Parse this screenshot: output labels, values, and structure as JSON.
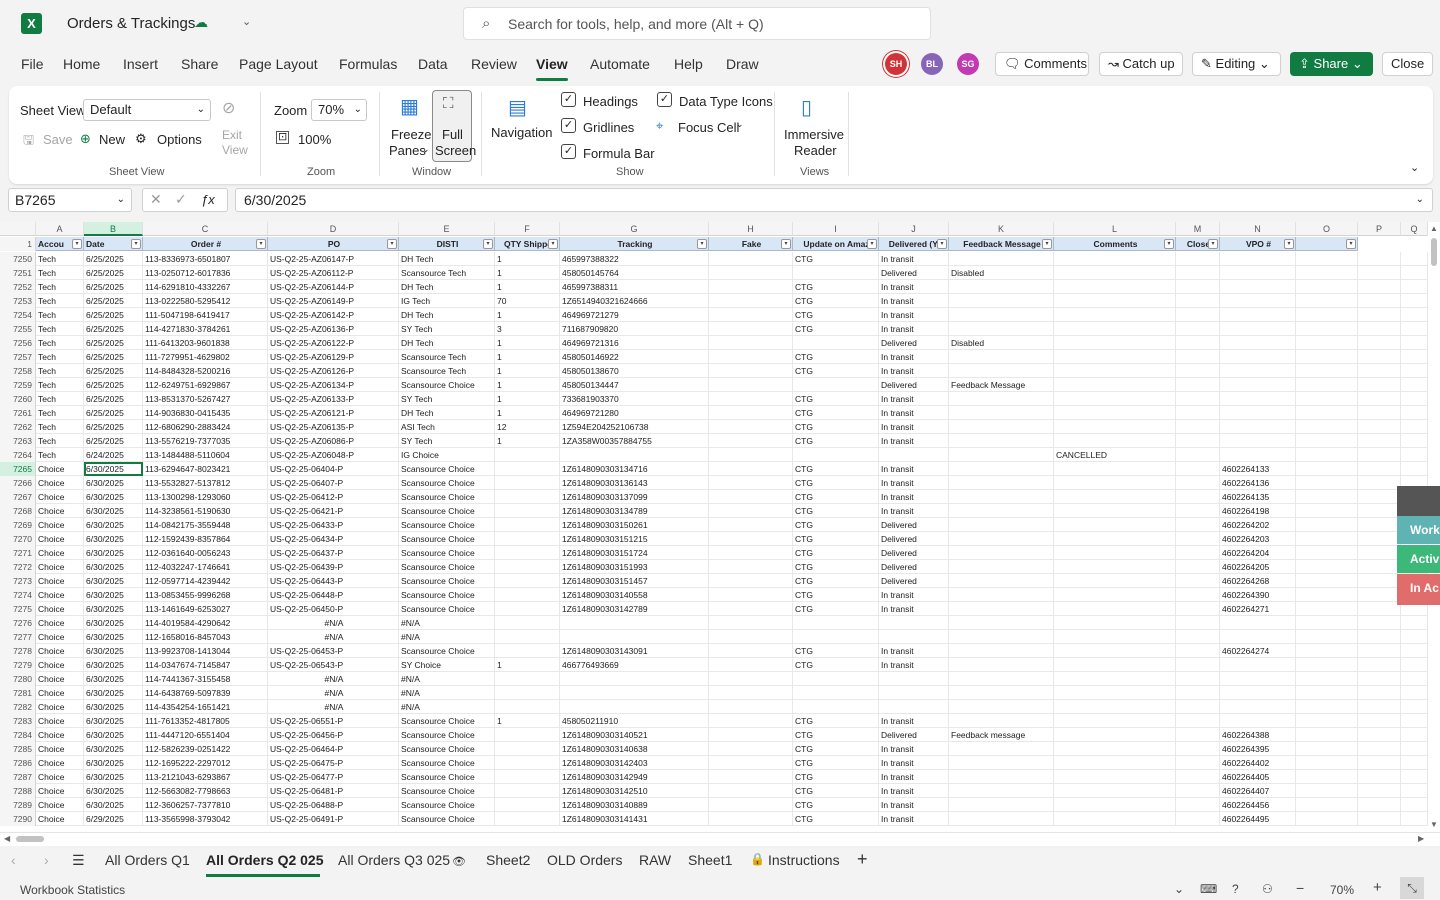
{
  "title": {
    "app_name": "Orders & Trackings",
    "search_placeholder": "Search for tools, help, and more (Alt + Q)",
    "logo_letter": "X"
  },
  "menu": [
    "File",
    "Home",
    "Insert",
    "Share",
    "Page Layout",
    "Formulas",
    "Data",
    "Review",
    "View",
    "Automate",
    "Help",
    "Draw"
  ],
  "avatars": [
    "SH",
    "BL",
    "SG"
  ],
  "topbar": {
    "comments": "Comments",
    "catchup": "Catch up",
    "editing": "Editing",
    "share": "Share",
    "close": "Close"
  },
  "ribbon": {
    "sheet_view_label": "Sheet View",
    "sheet_view_value": "Default",
    "exit_view": "Exit\nView",
    "save": "Save",
    "new": "New",
    "options": "Options",
    "grp_sheetview": "Sheet View",
    "zoom_label": "Zoom",
    "zoom_value": "70%",
    "zoom_100": "100%",
    "grp_zoom": "Zoom",
    "freeze": "Freeze",
    "panes": "Panes",
    "full": "Full",
    "screen": "Screen",
    "grp_window": "Window",
    "navigation": "Navigation",
    "headings": "Headings",
    "gridlines": "Gridlines",
    "formula_bar": "Formula Bar",
    "data_type_icons": "Data Type Icons",
    "focus_cell": "Focus Cell",
    "grp_show": "Show",
    "immersive": "Immersive",
    "reader": "Reader",
    "grp_views": "Views"
  },
  "formula": {
    "namebox": "B7265",
    "value": "6/30/2025"
  },
  "columns": [
    "A",
    "B",
    "C",
    "D",
    "E",
    "F",
    "G",
    "H",
    "I",
    "J",
    "K",
    "L",
    "M",
    "N",
    "O",
    "P",
    "Q"
  ],
  "headers": [
    "Accou",
    "Date",
    "Order #",
    "PO",
    "DISTI",
    "QTY Shippe",
    "Tracking",
    "Fake",
    "Update on Amaz",
    "Delivered (Y/",
    "Feedback Message",
    "Comments",
    "Close",
    "VPO #",
    ""
  ],
  "header_rownum": "1",
  "rows": [
    [
      "7250",
      "Tech",
      "6/25/2025",
      "113-8336973-6501807",
      "US-Q2-25-AZ06147-P",
      "DH Tech",
      "1",
      "465997388322",
      "",
      "CTG",
      "In transit",
      "",
      "",
      "",
      ""
    ],
    [
      "7251",
      "Tech",
      "6/25/2025",
      "113-0250712-6017836",
      "US-Q2-25-AZ06112-P",
      "Scansource Tech",
      "1",
      "458050145764",
      "",
      "",
      "Delivered",
      "Disabled",
      "",
      "",
      ""
    ],
    [
      "7252",
      "Tech",
      "6/25/2025",
      "114-6291810-4332267",
      "US-Q2-25-AZ06144-P",
      "DH Tech",
      "1",
      "465997388311",
      "",
      "CTG",
      "In transit",
      "",
      "",
      "",
      ""
    ],
    [
      "7253",
      "Tech",
      "6/25/2025",
      "113-0222580-5295412",
      "US-Q2-25-AZ06149-P",
      "IG Tech",
      "70",
      "1Z6514940321624666",
      "",
      "CTG",
      "In transit",
      "",
      "",
      "",
      ""
    ],
    [
      "7254",
      "Tech",
      "6/25/2025",
      "111-5047198-6419417",
      "US-Q2-25-AZ06142-P",
      "DH Tech",
      "1",
      "464969721279",
      "",
      "CTG",
      "In transit",
      "",
      "",
      "",
      ""
    ],
    [
      "7255",
      "Tech",
      "6/25/2025",
      "114-4271830-3784261",
      "US-Q2-25-AZ06136-P",
      "SY Tech",
      "3",
      "711687909820",
      "",
      "CTG",
      "In transit",
      "",
      "",
      "",
      ""
    ],
    [
      "7256",
      "Tech",
      "6/25/2025",
      "111-6413203-9601838",
      "US-Q2-25-AZ06122-P",
      "DH Tech",
      "1",
      "464969721316",
      "",
      "",
      "Delivered",
      "Disabled",
      "",
      "",
      ""
    ],
    [
      "7257",
      "Tech",
      "6/25/2025",
      "111-7279951-4629802",
      "US-Q2-25-AZ06129-P",
      "Scansource Tech",
      "1",
      "458050146922",
      "",
      "CTG",
      "In transit",
      "",
      "",
      "",
      ""
    ],
    [
      "7258",
      "Tech",
      "6/25/2025",
      "114-8484328-5200216",
      "US-Q2-25-AZ06126-P",
      "Scansource Tech",
      "1",
      "458050138670",
      "",
      "CTG",
      "In transit",
      "",
      "",
      "",
      ""
    ],
    [
      "7259",
      "Tech",
      "6/25/2025",
      "112-6249751-6929867",
      "US-Q2-25-AZ06134-P",
      "Scansource Choice",
      "1",
      "458050134447",
      "",
      "",
      "Delivered",
      "Feedback Message",
      "",
      "",
      ""
    ],
    [
      "7260",
      "Tech",
      "6/25/2025",
      "113-8531370-5267427",
      "US-Q2-25-AZ06133-P",
      "SY Tech",
      "1",
      "733681903370",
      "",
      "CTG",
      "In transit",
      "",
      "",
      "",
      ""
    ],
    [
      "7261",
      "Tech",
      "6/25/2025",
      "114-9036830-0415435",
      "US-Q2-25-AZ06121-P",
      "DH Tech",
      "1",
      "464969721280",
      "",
      "CTG",
      "In transit",
      "",
      "",
      "",
      ""
    ],
    [
      "7262",
      "Tech",
      "6/25/2025",
      "112-6806290-2883424",
      "US-Q2-25-AZ06135-P",
      "ASI Tech",
      "12",
      "1Z594E204252106738",
      "",
      "CTG",
      "In transit",
      "",
      "",
      "",
      ""
    ],
    [
      "7263",
      "Tech",
      "6/25/2025",
      "113-5576219-7377035",
      "US-Q2-25-AZ06086-P",
      "SY Tech",
      "1",
      "1ZA358W00357884755",
      "",
      "CTG",
      "In transit",
      "",
      "",
      "",
      ""
    ],
    [
      "7264",
      "Tech",
      "6/24/2025",
      "113-1484488-5110604",
      "US-Q2-25-AZ06048-P",
      "IG Choice",
      "",
      "",
      "",
      "",
      "",
      "",
      "CANCELLED",
      "",
      ""
    ],
    [
      "7265",
      "Choice",
      "6/30/2025",
      "113-6294647-8023421",
      "US-Q2-25-06404-P",
      "Scansource Choice",
      "",
      "1Z6148090303134716",
      "",
      "CTG",
      "In transit",
      "",
      "",
      "",
      "4602264133"
    ],
    [
      "7266",
      "Choice",
      "6/30/2025",
      "113-5532827-5137812",
      "US-Q2-25-06407-P",
      "Scansource Choice",
      "",
      "1Z6148090303136143",
      "",
      "CTG",
      "In transit",
      "",
      "",
      "",
      "4602264136"
    ],
    [
      "7267",
      "Choice",
      "6/30/2025",
      "113-1300298-1293060",
      "US-Q2-25-06412-P",
      "Scansource Choice",
      "",
      "1Z6148090303137099",
      "",
      "CTG",
      "In transit",
      "",
      "",
      "",
      "4602264135"
    ],
    [
      "7268",
      "Choice",
      "6/30/2025",
      "114-3238561-5190630",
      "US-Q2-25-06421-P",
      "Scansource Choice",
      "",
      "1Z6148090303134789",
      "",
      "CTG",
      "In transit",
      "",
      "",
      "",
      "4602264198"
    ],
    [
      "7269",
      "Choice",
      "6/30/2025",
      "114-0842175-3559448",
      "US-Q2-25-06433-P",
      "Scansource Choice",
      "",
      "1Z6148090303150261",
      "",
      "CTG",
      "Delivered",
      "",
      "",
      "",
      "4602264202"
    ],
    [
      "7270",
      "Choice",
      "6/30/2025",
      "112-1592439-8357864",
      "US-Q2-25-06434-P",
      "Scansource Choice",
      "",
      "1Z6148090303151215",
      "",
      "CTG",
      "Delivered",
      "",
      "",
      "",
      "4602264203"
    ],
    [
      "7271",
      "Choice",
      "6/30/2025",
      "112-0361640-0056243",
      "US-Q2-25-06437-P",
      "Scansource Choice",
      "",
      "1Z6148090303151724",
      "",
      "CTG",
      "Delivered",
      "",
      "",
      "",
      "4602264204"
    ],
    [
      "7272",
      "Choice",
      "6/30/2025",
      "112-4032247-1746641",
      "US-Q2-25-06439-P",
      "Scansource Choice",
      "",
      "1Z6148090303151993",
      "",
      "CTG",
      "Delivered",
      "",
      "",
      "",
      "4602264205"
    ],
    [
      "7273",
      "Choice",
      "6/30/2025",
      "112-0597714-4239442",
      "US-Q2-25-06443-P",
      "Scansource Choice",
      "",
      "1Z6148090303151457",
      "",
      "CTG",
      "Delivered",
      "",
      "",
      "",
      "4602264268"
    ],
    [
      "7274",
      "Choice",
      "6/30/2025",
      "113-0853455-9996268",
      "US-Q2-25-06448-P",
      "Scansource Choice",
      "",
      "1Z6148090303140558",
      "",
      "CTG",
      "In transit",
      "",
      "",
      "",
      "4602264390"
    ],
    [
      "7275",
      "Choice",
      "6/30/2025",
      "113-1461649-6253027",
      "US-Q2-25-06450-P",
      "Scansource Choice",
      "",
      "1Z6148090303142789",
      "",
      "CTG",
      "In transit",
      "",
      "",
      "",
      "4602264271"
    ],
    [
      "7276",
      "Choice",
      "6/30/2025",
      "114-4019584-4290642",
      "#N/A",
      "#N/A",
      "",
      "",
      "",
      "",
      "",
      "",
      "",
      "",
      ""
    ],
    [
      "7277",
      "Choice",
      "6/30/2025",
      "112-1658016-8457043",
      "#N/A",
      "#N/A",
      "",
      "",
      "",
      "",
      "",
      "",
      "",
      "",
      ""
    ],
    [
      "7278",
      "Choice",
      "6/30/2025",
      "113-9923708-1413044",
      "US-Q2-25-06453-P",
      "Scansource Choice",
      "",
      "1Z6148090303143091",
      "",
      "CTG",
      "In transit",
      "",
      "",
      "",
      "4602264274"
    ],
    [
      "7279",
      "Choice",
      "6/30/2025",
      "114-0347674-7145847",
      "US-Q2-25-06543-P",
      "SY Choice",
      "1",
      "466776493669",
      "",
      "CTG",
      "In transit",
      "",
      "",
      "",
      ""
    ],
    [
      "7280",
      "Choice",
      "6/30/2025",
      "114-7441367-3155458",
      "#N/A",
      "#N/A",
      "",
      "",
      "",
      "",
      "",
      "",
      "",
      "",
      ""
    ],
    [
      "7281",
      "Choice",
      "6/30/2025",
      "114-6438769-5097839",
      "#N/A",
      "#N/A",
      "",
      "",
      "",
      "",
      "",
      "",
      "",
      "",
      ""
    ],
    [
      "7282",
      "Choice",
      "6/30/2025",
      "114-4354254-1651421",
      "#N/A",
      "#N/A",
      "",
      "",
      "",
      "",
      "",
      "",
      "",
      "",
      ""
    ],
    [
      "7283",
      "Choice",
      "6/30/2025",
      "111-7613352-4817805",
      "US-Q2-25-06551-P",
      "Scansource Choice",
      "1",
      "458050211910",
      "",
      "CTG",
      "In transit",
      "",
      "",
      "",
      ""
    ],
    [
      "7284",
      "Choice",
      "6/30/2025",
      "111-4447120-6551404",
      "US-Q2-25-06456-P",
      "Scansource Choice",
      "",
      "1Z6148090303140521",
      "",
      "CTG",
      "Delivered",
      "Feedback message",
      "",
      "",
      "4602264388"
    ],
    [
      "7285",
      "Choice",
      "6/30/2025",
      "112-5826239-0251422",
      "US-Q2-25-06464-P",
      "Scansource Choice",
      "",
      "1Z6148090303140638",
      "",
      "CTG",
      "In transit",
      "",
      "",
      "",
      "4602264395"
    ],
    [
      "7286",
      "Choice",
      "6/30/2025",
      "112-1695222-2297012",
      "US-Q2-25-06475-P",
      "Scansource Choice",
      "",
      "1Z6148090303142403",
      "",
      "CTG",
      "In transit",
      "",
      "",
      "",
      "4602264402"
    ],
    [
      "7287",
      "Choice",
      "6/30/2025",
      "113-2121043-6293867",
      "US-Q2-25-06477-P",
      "Scansource Choice",
      "",
      "1Z6148090303142949",
      "",
      "CTG",
      "In transit",
      "",
      "",
      "",
      "4602264405"
    ],
    [
      "7288",
      "Choice",
      "6/30/2025",
      "112-5663082-7798663",
      "US-Q2-25-06481-P",
      "Scansource Choice",
      "",
      "1Z6148090303142510",
      "",
      "CTG",
      "In transit",
      "",
      "",
      "",
      "4602264407"
    ],
    [
      "7289",
      "Choice",
      "6/30/2025",
      "112-3606257-7377810",
      "US-Q2-25-06488-P",
      "Scansource Choice",
      "",
      "1Z6148090303140889",
      "",
      "CTG",
      "In transit",
      "",
      "",
      "",
      "4602264456"
    ],
    [
      "7290",
      "Choice",
      "6/29/2025",
      "113-3565998-3793042",
      "US-Q2-25-06491-P",
      "Scansource Choice",
      "",
      "1Z6148090303141431",
      "",
      "CTG",
      "In transit",
      "",
      "",
      "",
      "4602264495"
    ]
  ],
  "side_panel": [
    {
      "label": "Work",
      "color": "#5fb3b3"
    },
    {
      "label": "Activ",
      "color": "#3cb878"
    },
    {
      "label": "In Ac",
      "color": "#e06c6c"
    }
  ],
  "tabs": [
    "All Orders Q1",
    "All Orders Q2 025",
    "All Orders Q3 025",
    "Sheet2",
    "OLD Orders",
    "RAW",
    "Sheet1",
    "Instructions"
  ],
  "status": {
    "left": "Workbook Statistics",
    "zoom": "70%"
  }
}
